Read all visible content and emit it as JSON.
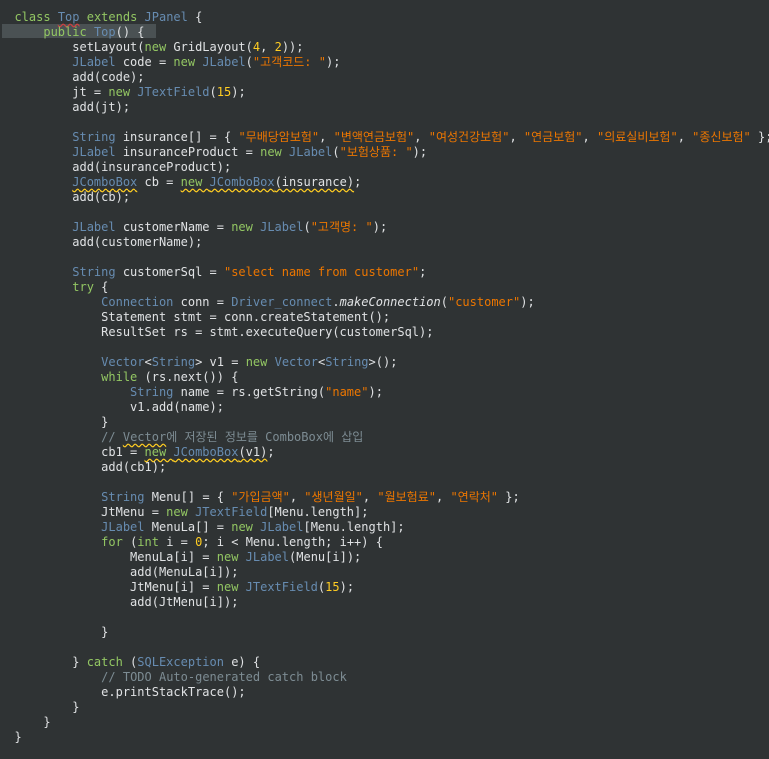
{
  "editor": {
    "theme": {
      "background": "#2f3334",
      "keyword": "#93c763",
      "type": "#678cb1",
      "string": "#ec7600",
      "number": "#ffcd22",
      "comment": "#7d8c93",
      "plain": "#e0e2e4",
      "highlight": "#4a5153"
    },
    "lines": [
      [
        {
          "t": "  "
        },
        {
          "c": "kw",
          "t": "class "
        },
        {
          "c": "ty ulr",
          "t": "Top"
        },
        {
          "c": "kw",
          "t": " extends "
        },
        {
          "c": "ty",
          "t": "JPanel"
        },
        {
          "t": " {"
        }
      ],
      [
        {
          "t": "      "
        },
        {
          "c": "kw",
          "t": "public "
        },
        {
          "c": "ty",
          "t": "Top"
        },
        {
          "t": "() {"
        }
      ],
      [
        {
          "t": "          setLayout("
        },
        {
          "c": "kw",
          "t": "new "
        },
        {
          "t": "GridLayout("
        },
        {
          "c": "nm",
          "t": "4"
        },
        {
          "t": ", "
        },
        {
          "c": "nm",
          "t": "2"
        },
        {
          "t": "));"
        }
      ],
      [
        {
          "t": "          "
        },
        {
          "c": "ty",
          "t": "JLabel"
        },
        {
          "t": " code = "
        },
        {
          "c": "kw",
          "t": "new "
        },
        {
          "c": "ty",
          "t": "JLabel"
        },
        {
          "t": "("
        },
        {
          "c": "st",
          "t": "\"고객코드: \""
        },
        {
          "t": ");"
        }
      ],
      [
        {
          "t": "          add(code);"
        }
      ],
      [
        {
          "t": "          jt = "
        },
        {
          "c": "kw",
          "t": "new "
        },
        {
          "c": "ty",
          "t": "JTextField"
        },
        {
          "t": "("
        },
        {
          "c": "nm",
          "t": "15"
        },
        {
          "t": ");"
        }
      ],
      [
        {
          "t": "          add(jt);"
        }
      ],
      [
        {
          "t": ""
        }
      ],
      [
        {
          "t": "          "
        },
        {
          "c": "ty",
          "t": "String"
        },
        {
          "t": " insurance[] = { "
        },
        {
          "c": "st",
          "t": "\"무배당암보험\""
        },
        {
          "t": ", "
        },
        {
          "c": "st",
          "t": "\"변액연금보험\""
        },
        {
          "t": ", "
        },
        {
          "c": "st",
          "t": "\"여성건강보험\""
        },
        {
          "t": ", "
        },
        {
          "c": "st",
          "t": "\"연금보험\""
        },
        {
          "t": ", "
        },
        {
          "c": "st",
          "t": "\"의료실비보험\""
        },
        {
          "t": ", "
        },
        {
          "c": "st",
          "t": "\"종신보험\""
        },
        {
          "t": " };"
        }
      ],
      [
        {
          "t": "          "
        },
        {
          "c": "ty",
          "t": "JLabel"
        },
        {
          "t": " insuranceProduct = "
        },
        {
          "c": "kw",
          "t": "new "
        },
        {
          "c": "ty",
          "t": "JLabel"
        },
        {
          "t": "("
        },
        {
          "c": "st",
          "t": "\"보험상품: \""
        },
        {
          "t": ");"
        }
      ],
      [
        {
          "t": "          add(insuranceProduct);"
        }
      ],
      [
        {
          "t": "          "
        },
        {
          "c": "ty ul",
          "t": "JComboBox"
        },
        {
          "t": " cb = "
        },
        {
          "c": "kw ul",
          "t": "new "
        },
        {
          "c": "ty ul",
          "t": "JComboBox"
        },
        {
          "c": "ul",
          "t": "(insurance)"
        },
        {
          "t": ";"
        }
      ],
      [
        {
          "t": "          add(cb);"
        }
      ],
      [
        {
          "t": ""
        }
      ],
      [
        {
          "t": "          "
        },
        {
          "c": "ty",
          "t": "JLabel"
        },
        {
          "t": " customerName = "
        },
        {
          "c": "kw",
          "t": "new "
        },
        {
          "c": "ty",
          "t": "JLabel"
        },
        {
          "t": "("
        },
        {
          "c": "st",
          "t": "\"고객명: \""
        },
        {
          "t": ");"
        }
      ],
      [
        {
          "t": "          add(customerName);"
        }
      ],
      [
        {
          "t": ""
        }
      ],
      [
        {
          "t": "          "
        },
        {
          "c": "ty",
          "t": "String"
        },
        {
          "t": " customerSql = "
        },
        {
          "c": "st",
          "t": "\"select name from customer\""
        },
        {
          "t": ";"
        }
      ],
      [
        {
          "t": "          "
        },
        {
          "c": "kw",
          "t": "try"
        },
        {
          "t": " {"
        }
      ],
      [
        {
          "t": "              "
        },
        {
          "c": "ty",
          "t": "Connection"
        },
        {
          "t": " conn = "
        },
        {
          "c": "ty",
          "t": "Driver_connect"
        },
        {
          "t": "."
        },
        {
          "c": "it",
          "t": "makeConnection"
        },
        {
          "t": "("
        },
        {
          "c": "st",
          "t": "\"customer\""
        },
        {
          "t": ");"
        }
      ],
      [
        {
          "t": "              Statement stmt = conn.createStatement();"
        }
      ],
      [
        {
          "t": "              ResultSet rs = stmt.executeQuery(customerSql);"
        }
      ],
      [
        {
          "t": ""
        }
      ],
      [
        {
          "t": "              "
        },
        {
          "c": "ty",
          "t": "Vector"
        },
        {
          "t": "<"
        },
        {
          "c": "ty",
          "t": "String"
        },
        {
          "t": "> v1 = "
        },
        {
          "c": "kw",
          "t": "new "
        },
        {
          "c": "ty",
          "t": "Vector"
        },
        {
          "t": "<"
        },
        {
          "c": "ty",
          "t": "String"
        },
        {
          "t": ">();"
        }
      ],
      [
        {
          "t": "              "
        },
        {
          "c": "kw",
          "t": "while"
        },
        {
          "t": " (rs.next()) {"
        }
      ],
      [
        {
          "t": "                  "
        },
        {
          "c": "ty",
          "t": "String"
        },
        {
          "t": " name = rs.getString("
        },
        {
          "c": "st",
          "t": "\"name\""
        },
        {
          "t": ");"
        }
      ],
      [
        {
          "t": "                  v1.add(name);"
        }
      ],
      [
        {
          "t": "              }"
        }
      ],
      [
        {
          "t": "              "
        },
        {
          "c": "cm",
          "t": "// "
        },
        {
          "c": "cm ul",
          "t": "Vector"
        },
        {
          "c": "cm",
          "t": "에 저장된 정보를 ComboBox에 삽입"
        }
      ],
      [
        {
          "t": "              cb1 = "
        },
        {
          "c": "kw ul",
          "t": "new "
        },
        {
          "c": "ty ul",
          "t": "JComboBox"
        },
        {
          "c": "ul",
          "t": "(v1)"
        },
        {
          "t": ";"
        }
      ],
      [
        {
          "t": "              add(cb1);"
        }
      ],
      [
        {
          "t": ""
        }
      ],
      [
        {
          "t": "              "
        },
        {
          "c": "ty",
          "t": "String"
        },
        {
          "t": " Menu[] = { "
        },
        {
          "c": "st",
          "t": "\"가입금액\""
        },
        {
          "t": ", "
        },
        {
          "c": "st",
          "t": "\"생년월일\""
        },
        {
          "t": ", "
        },
        {
          "c": "st",
          "t": "\"월보험료\""
        },
        {
          "t": ", "
        },
        {
          "c": "st",
          "t": "\"연락처\""
        },
        {
          "t": " };"
        }
      ],
      [
        {
          "t": "              JtMenu = "
        },
        {
          "c": "kw",
          "t": "new "
        },
        {
          "c": "ty",
          "t": "JTextField"
        },
        {
          "t": "[Menu.length];"
        }
      ],
      [
        {
          "t": "              "
        },
        {
          "c": "ty",
          "t": "JLabel"
        },
        {
          "t": " MenuLa[] = "
        },
        {
          "c": "kw",
          "t": "new "
        },
        {
          "c": "ty",
          "t": "JLabel"
        },
        {
          "t": "[Menu.length];"
        }
      ],
      [
        {
          "t": "              "
        },
        {
          "c": "kw",
          "t": "for"
        },
        {
          "t": " ("
        },
        {
          "c": "kw",
          "t": "int"
        },
        {
          "t": " i = "
        },
        {
          "c": "nm",
          "t": "0"
        },
        {
          "t": "; i < Menu.length; i++) {"
        }
      ],
      [
        {
          "t": "                  MenuLa[i] = "
        },
        {
          "c": "kw",
          "t": "new "
        },
        {
          "c": "ty",
          "t": "JLabel"
        },
        {
          "t": "(Menu[i]);"
        }
      ],
      [
        {
          "t": "                  add(MenuLa[i]);"
        }
      ],
      [
        {
          "t": "                  JtMenu[i] = "
        },
        {
          "c": "kw",
          "t": "new "
        },
        {
          "c": "ty",
          "t": "JTextField"
        },
        {
          "t": "("
        },
        {
          "c": "nm",
          "t": "15"
        },
        {
          "t": ");"
        }
      ],
      [
        {
          "t": "                  add(JtMenu[i]);"
        }
      ],
      [
        {
          "t": ""
        }
      ],
      [
        {
          "t": "              }"
        }
      ],
      [
        {
          "t": ""
        }
      ],
      [
        {
          "t": "          } "
        },
        {
          "c": "kw",
          "t": "catch"
        },
        {
          "t": " ("
        },
        {
          "c": "ty",
          "t": "SQLException"
        },
        {
          "t": " e) {"
        }
      ],
      [
        {
          "t": "              "
        },
        {
          "c": "cm",
          "t": "// "
        },
        {
          "c": "cm",
          "t": "TODO"
        },
        {
          "c": "cm",
          "t": " Auto-generated catch block"
        }
      ],
      [
        {
          "t": "              e.printStackTrace();"
        }
      ],
      [
        {
          "t": "          }"
        }
      ],
      [
        {
          "t": "      }"
        }
      ],
      [
        {
          "t": "  }"
        }
      ]
    ]
  }
}
